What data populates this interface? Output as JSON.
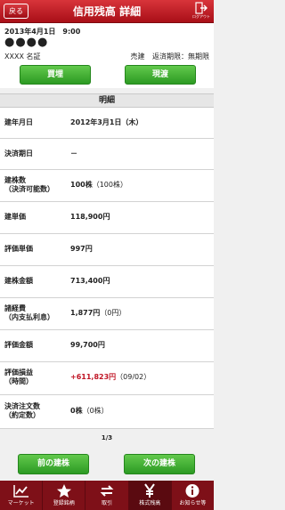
{
  "header": {
    "back_label": "戻る",
    "title": "信用残高 詳細",
    "logout_label": "ログアウト"
  },
  "info": {
    "date": "2013年4月1日　9:00",
    "account": "●●●●",
    "stock_name": "XXXX 名証",
    "trade_type": "売建",
    "repay_limit": "返済期限：無期限"
  },
  "actions": {
    "buy_label": "買埋",
    "close_label": "現渡"
  },
  "section": {
    "title": "明細"
  },
  "details": [
    {
      "label": "建年月日",
      "value": "2012年3月1日（木）",
      "label2": "",
      "sub": ""
    },
    {
      "label": "決済期日",
      "value": "－",
      "label2": "",
      "sub": ""
    },
    {
      "label": "建株数",
      "label2": "（決済可能数）",
      "value": "100株",
      "sub": "（100株）"
    },
    {
      "label": "建単価",
      "value": "118,900円",
      "label2": "",
      "sub": ""
    },
    {
      "label": "評価単価",
      "value": "997円",
      "label2": "",
      "sub": ""
    },
    {
      "label": "建株金額",
      "value": "713,400円",
      "label2": "",
      "sub": ""
    },
    {
      "label": "諸経費",
      "label2": "（内支払利息）",
      "value": "1,877円",
      "sub": "（0円）"
    },
    {
      "label": "評価金額",
      "value": "99,700円",
      "label2": "",
      "sub": ""
    },
    {
      "label": "評価損益",
      "label2": "（時間）",
      "value": "+611,823円",
      "sub": "（09/02）"
    },
    {
      "label": "決済注文数",
      "label2": "（約定数）",
      "value": "0株",
      "sub": "（0株）"
    }
  ],
  "pager": {
    "page": "1/3",
    "prev_label": "前の建株",
    "next_label": "次の建株"
  },
  "nav": [
    {
      "label": "マーケット",
      "icon": "chart-icon"
    },
    {
      "label": "登録銘柄",
      "icon": "star-icon"
    },
    {
      "label": "取引",
      "icon": "trade-icon"
    },
    {
      "label": "株式残高",
      "icon": "yen-icon"
    },
    {
      "label": "お知らせ等",
      "icon": "info-icon"
    }
  ],
  "colors": {
    "header": "#b51b22",
    "button_green": "#3ea833",
    "profit_red": "#c01525"
  }
}
